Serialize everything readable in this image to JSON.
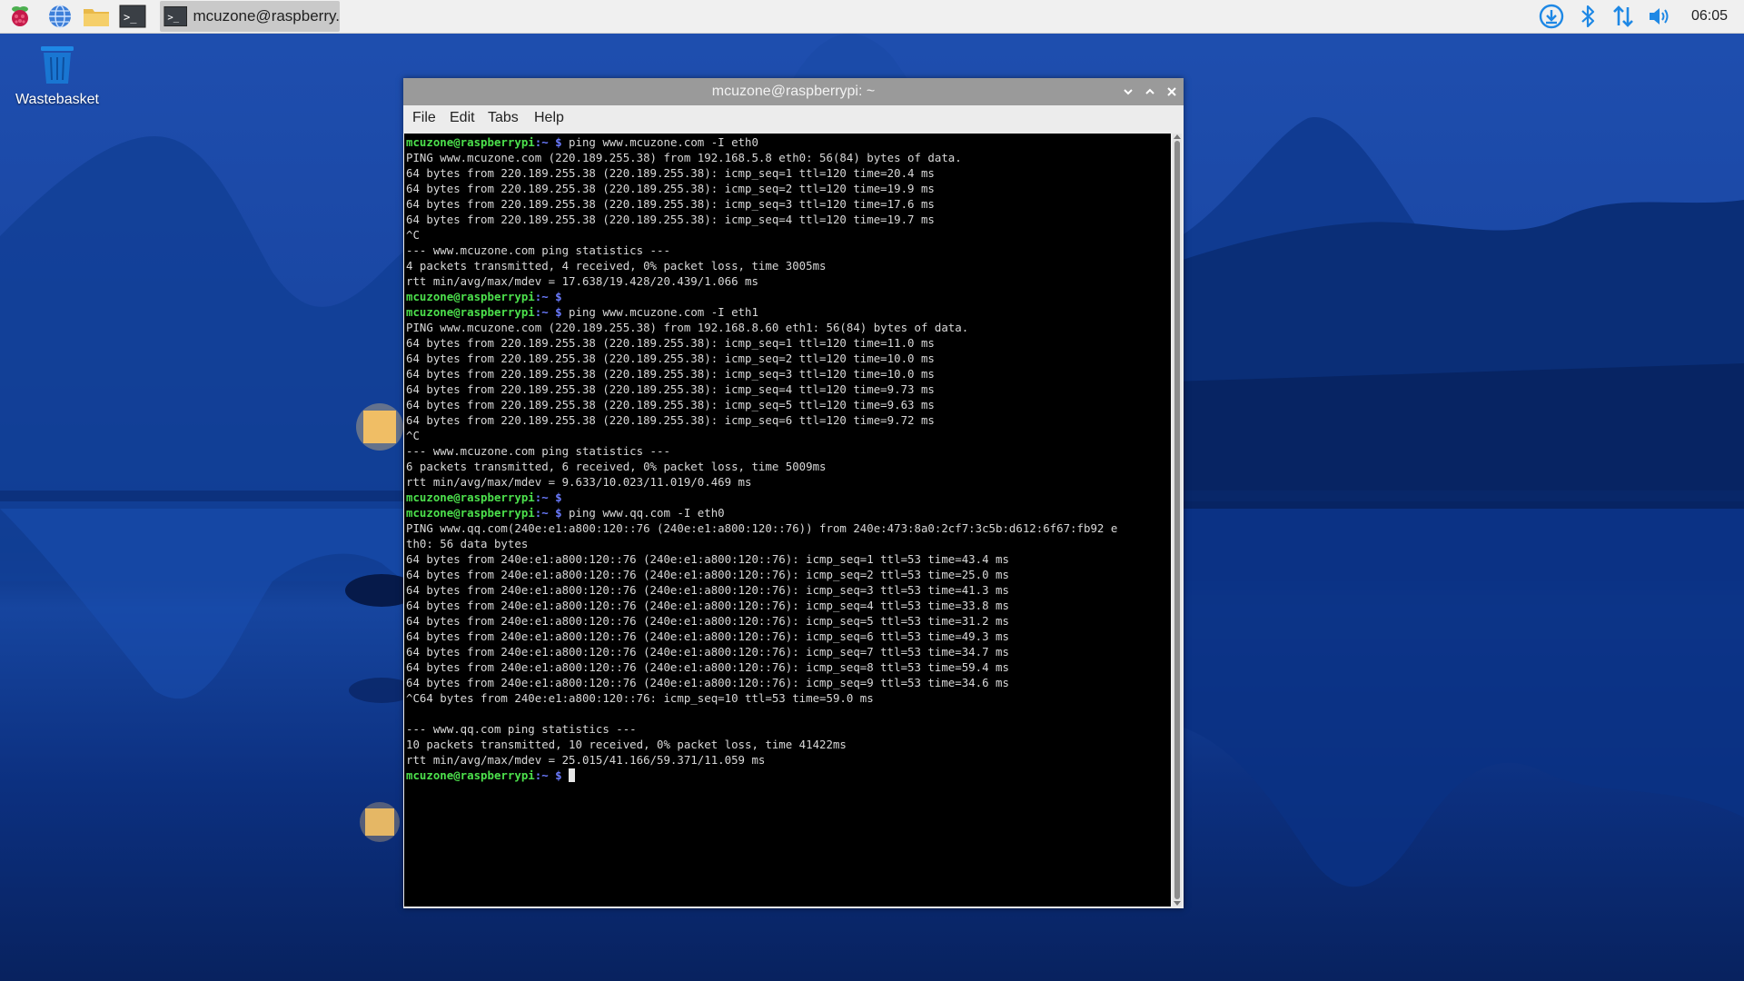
{
  "taskbar": {
    "launchers": [
      {
        "name": "raspberry-menu-icon"
      },
      {
        "name": "web-browser-icon"
      },
      {
        "name": "file-manager-icon"
      },
      {
        "name": "terminal-icon"
      }
    ],
    "active_task_label": "mcuzone@raspberry...",
    "tray": [
      "download-icon",
      "bluetooth-icon",
      "network-icon",
      "volume-icon"
    ],
    "clock": "06:05"
  },
  "desktop": {
    "icons": [
      {
        "label": "Wastebasket",
        "icon": "trash-icon"
      }
    ]
  },
  "window": {
    "title": "mcuzone@raspberrypi: ~",
    "menu": [
      "File",
      "Edit",
      "Tabs",
      "Help"
    ],
    "prompt_user": "mcuzone@raspberrypi",
    "prompt_path": ":~ $",
    "lines": [
      {
        "type": "prompt",
        "cmd": " ping www.mcuzone.com -I eth0"
      },
      {
        "type": "out",
        "text": "PING www.mcuzone.com (220.189.255.38) from 192.168.5.8 eth0: 56(84) bytes of data."
      },
      {
        "type": "out",
        "text": "64 bytes from 220.189.255.38 (220.189.255.38): icmp_seq=1 ttl=120 time=20.4 ms"
      },
      {
        "type": "out",
        "text": "64 bytes from 220.189.255.38 (220.189.255.38): icmp_seq=2 ttl=120 time=19.9 ms"
      },
      {
        "type": "out",
        "text": "64 bytes from 220.189.255.38 (220.189.255.38): icmp_seq=3 ttl=120 time=17.6 ms"
      },
      {
        "type": "out",
        "text": "64 bytes from 220.189.255.38 (220.189.255.38): icmp_seq=4 ttl=120 time=19.7 ms"
      },
      {
        "type": "out",
        "text": "^C"
      },
      {
        "type": "out",
        "text": "--- www.mcuzone.com ping statistics ---"
      },
      {
        "type": "out",
        "text": "4 packets transmitted, 4 received, 0% packet loss, time 3005ms"
      },
      {
        "type": "out",
        "text": "rtt min/avg/max/mdev = 17.638/19.428/20.439/1.066 ms"
      },
      {
        "type": "prompt",
        "cmd": ""
      },
      {
        "type": "prompt",
        "cmd": " ping www.mcuzone.com -I eth1"
      },
      {
        "type": "out",
        "text": "PING www.mcuzone.com (220.189.255.38) from 192.168.8.60 eth1: 56(84) bytes of data."
      },
      {
        "type": "out",
        "text": "64 bytes from 220.189.255.38 (220.189.255.38): icmp_seq=1 ttl=120 time=11.0 ms"
      },
      {
        "type": "out",
        "text": "64 bytes from 220.189.255.38 (220.189.255.38): icmp_seq=2 ttl=120 time=10.0 ms"
      },
      {
        "type": "out",
        "text": "64 bytes from 220.189.255.38 (220.189.255.38): icmp_seq=3 ttl=120 time=10.0 ms"
      },
      {
        "type": "out",
        "text": "64 bytes from 220.189.255.38 (220.189.255.38): icmp_seq=4 ttl=120 time=9.73 ms"
      },
      {
        "type": "out",
        "text": "64 bytes from 220.189.255.38 (220.189.255.38): icmp_seq=5 ttl=120 time=9.63 ms"
      },
      {
        "type": "out",
        "text": "64 bytes from 220.189.255.38 (220.189.255.38): icmp_seq=6 ttl=120 time=9.72 ms"
      },
      {
        "type": "out",
        "text": "^C"
      },
      {
        "type": "out",
        "text": "--- www.mcuzone.com ping statistics ---"
      },
      {
        "type": "out",
        "text": "6 packets transmitted, 6 received, 0% packet loss, time 5009ms"
      },
      {
        "type": "out",
        "text": "rtt min/avg/max/mdev = 9.633/10.023/11.019/0.469 ms"
      },
      {
        "type": "prompt",
        "cmd": ""
      },
      {
        "type": "prompt",
        "cmd": " ping www.qq.com -I eth0"
      },
      {
        "type": "out",
        "text": "PING www.qq.com(240e:e1:a800:120::76 (240e:e1:a800:120::76)) from 240e:473:8a0:2cf7:3c5b:d612:6f67:fb92 e"
      },
      {
        "type": "out",
        "text": "th0: 56 data bytes"
      },
      {
        "type": "out",
        "text": "64 bytes from 240e:e1:a800:120::76 (240e:e1:a800:120::76): icmp_seq=1 ttl=53 time=43.4 ms"
      },
      {
        "type": "out",
        "text": "64 bytes from 240e:e1:a800:120::76 (240e:e1:a800:120::76): icmp_seq=2 ttl=53 time=25.0 ms"
      },
      {
        "type": "out",
        "text": "64 bytes from 240e:e1:a800:120::76 (240e:e1:a800:120::76): icmp_seq=3 ttl=53 time=41.3 ms"
      },
      {
        "type": "out",
        "text": "64 bytes from 240e:e1:a800:120::76 (240e:e1:a800:120::76): icmp_seq=4 ttl=53 time=33.8 ms"
      },
      {
        "type": "out",
        "text": "64 bytes from 240e:e1:a800:120::76 (240e:e1:a800:120::76): icmp_seq=5 ttl=53 time=31.2 ms"
      },
      {
        "type": "out",
        "text": "64 bytes from 240e:e1:a800:120::76 (240e:e1:a800:120::76): icmp_seq=6 ttl=53 time=49.3 ms"
      },
      {
        "type": "out",
        "text": "64 bytes from 240e:e1:a800:120::76 (240e:e1:a800:120::76): icmp_seq=7 ttl=53 time=34.7 ms"
      },
      {
        "type": "out",
        "text": "64 bytes from 240e:e1:a800:120::76 (240e:e1:a800:120::76): icmp_seq=8 ttl=53 time=59.4 ms"
      },
      {
        "type": "out",
        "text": "64 bytes from 240e:e1:a800:120::76 (240e:e1:a800:120::76): icmp_seq=9 ttl=53 time=34.6 ms"
      },
      {
        "type": "out",
        "text": "^C64 bytes from 240e:e1:a800:120::76: icmp_seq=10 ttl=53 time=59.0 ms"
      },
      {
        "type": "out",
        "text": ""
      },
      {
        "type": "out",
        "text": "--- www.qq.com ping statistics ---"
      },
      {
        "type": "out",
        "text": "10 packets transmitted, 10 received, 0% packet loss, time 41422ms"
      },
      {
        "type": "out",
        "text": "rtt min/avg/max/mdev = 25.015/41.166/59.371/11.059 ms"
      },
      {
        "type": "prompt",
        "cmd": " ",
        "cursor": true
      }
    ]
  },
  "colors": {
    "prompt_user": "#4ce04c",
    "prompt_path": "#6b7bff",
    "terminal_bg": "#000000",
    "terminal_fg": "#d8d8d8"
  }
}
